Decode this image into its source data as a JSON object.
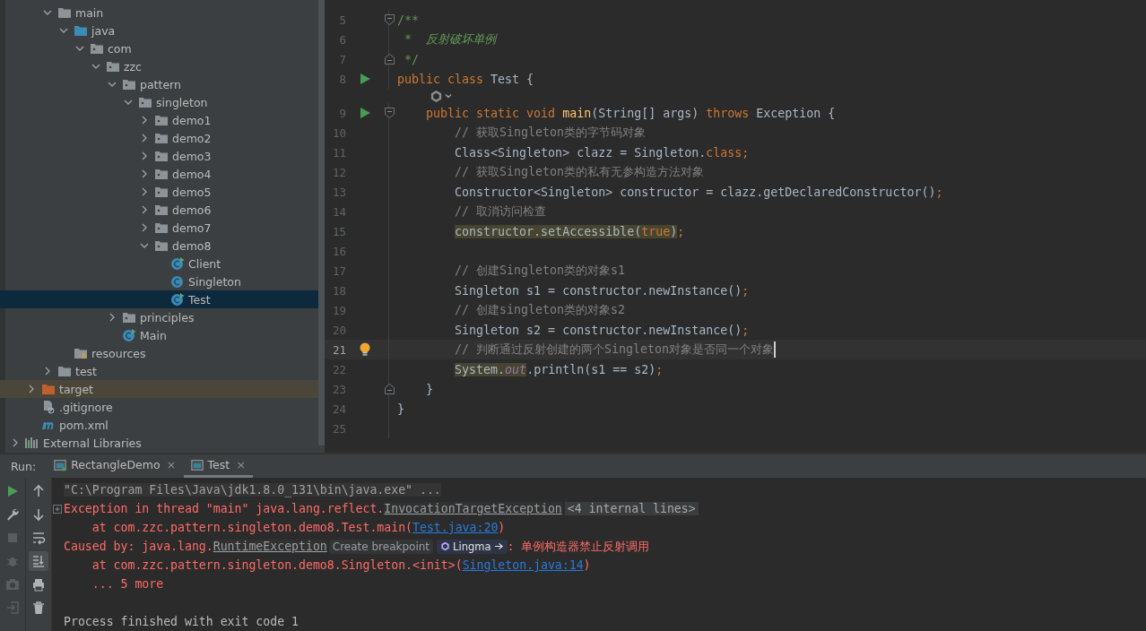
{
  "tree": [
    {
      "children": [
        {
          "children": [
            {
              "label": "main",
              "kind": "folder",
              "expanded": true,
              "selected": false,
              "children": [
                {
                  "label": "java",
                  "kind": "source",
                  "expanded": true,
                  "selected": false,
                  "children": [
                    {
                      "label": "com",
                      "kind": "package",
                      "expanded": true,
                      "selected": false,
                      "children": [
                        {
                          "label": "zzc",
                          "kind": "package",
                          "expanded": true,
                          "selected": false,
                          "children": [
                            {
                              "label": "pattern",
                              "kind": "package",
                              "expanded": true,
                              "selected": false,
                              "children": [
                                {
                                  "label": "singleton",
                                  "kind": "package",
                                  "expanded": true,
                                  "selected": false,
                                  "children": [
                                    {
                                      "label": "demo1",
                                      "kind": "package",
                                      "expanded": false,
                                      "selected": false
                                    },
                                    {
                                      "label": "demo2",
                                      "kind": "package",
                                      "expanded": false,
                                      "selected": false
                                    },
                                    {
                                      "label": "demo3",
                                      "kind": "package",
                                      "expanded": false,
                                      "selected": false
                                    },
                                    {
                                      "label": "demo4",
                                      "kind": "package",
                                      "expanded": false,
                                      "selected": false
                                    },
                                    {
                                      "label": "demo5",
                                      "kind": "package",
                                      "expanded": false,
                                      "selected": false
                                    },
                                    {
                                      "label": "demo6",
                                      "kind": "package",
                                      "expanded": false,
                                      "selected": false
                                    },
                                    {
                                      "label": "demo7",
                                      "kind": "package",
                                      "expanded": false,
                                      "selected": false
                                    },
                                    {
                                      "label": "demo8",
                                      "kind": "package",
                                      "expanded": true,
                                      "selected": false,
                                      "children": [
                                        {
                                          "label": "Client",
                                          "kind": "runnable",
                                          "selected": false
                                        },
                                        {
                                          "label": "Singleton",
                                          "kind": "class",
                                          "selected": false
                                        },
                                        {
                                          "label": "Test",
                                          "kind": "runnable",
                                          "selected": true
                                        }
                                      ]
                                    }
                                  ]
                                }
                              ]
                            },
                            {
                              "label": "principles",
                              "kind": "package",
                              "expanded": false,
                              "selected": false
                            },
                            {
                              "label": "Main",
                              "kind": "runnable",
                              "selected": false
                            }
                          ]
                        }
                      ]
                    }
                  ]
                },
                {
                  "label": "resources",
                  "kind": "resources",
                  "selected": false
                }
              ]
            },
            {
              "label": "test",
              "kind": "folder",
              "expanded": false,
              "selected": false
            }
          ]
        },
        {
          "label": "target",
          "kind": "excluded",
          "expanded": false,
          "selected": false
        },
        {
          "label": ".gitignore",
          "kind": "ignore",
          "selected": false
        },
        {
          "label": "pom.xml",
          "kind": "maven",
          "selected": false
        }
      ]
    },
    {
      "label": "External Libraries",
      "kind": "libraries",
      "expanded": false,
      "selected": false
    }
  ],
  "editor": {
    "lines": [
      {
        "kind": "code",
        "number": "5",
        "current": false,
        "gutter": [
          {
            "kind": "fold-start"
          }
        ],
        "tokens": [
          {
            "text": "/**",
            "kind": "doc"
          }
        ]
      },
      {
        "kind": "code",
        "number": "6",
        "current": false,
        "tokens": [
          {
            "text": " *  反射破坏单例",
            "kind": "doctext"
          }
        ]
      },
      {
        "kind": "code",
        "number": "7",
        "current": false,
        "gutter": [
          {
            "kind": "fold-end"
          }
        ],
        "tokens": [
          {
            "text": " */",
            "kind": "doc"
          }
        ]
      },
      {
        "kind": "code",
        "number": "8",
        "current": false,
        "gutter": [
          {
            "kind": "run"
          }
        ],
        "tokens": [
          {
            "text": "public class ",
            "kind": "keyword"
          },
          {
            "text": "Test {",
            "kind": "plain"
          }
        ]
      },
      {
        "kind": "inlay"
      },
      {
        "kind": "code",
        "number": "9",
        "current": false,
        "gutter": [
          {
            "kind": "run"
          },
          {
            "kind": "fold-start"
          }
        ],
        "tokens": [
          {
            "text": "    public static void ",
            "kind": "keyword"
          },
          {
            "text": "main",
            "kind": "method"
          },
          {
            "text": "(String[] args) ",
            "kind": "plain"
          },
          {
            "text": "throws ",
            "kind": "keyword"
          },
          {
            "text": "Exception {",
            "kind": "plain"
          }
        ]
      },
      {
        "kind": "code",
        "number": "10",
        "current": false,
        "tokens": [
          {
            "text": "        // 获取Singleton类的字节码对象",
            "kind": "comment"
          }
        ]
      },
      {
        "kind": "code",
        "number": "11",
        "current": false,
        "tokens": [
          {
            "text": "        Class<Singleton> clazz = Singleton.",
            "kind": "plain"
          },
          {
            "text": "class;",
            "kind": "keyword"
          }
        ]
      },
      {
        "kind": "code",
        "number": "12",
        "current": false,
        "tokens": [
          {
            "text": "        // 获取Singleton类的私有无参构造方法对象",
            "kind": "comment"
          }
        ]
      },
      {
        "kind": "code",
        "number": "13",
        "current": false,
        "tokens": [
          {
            "text": "        Constructor<Singleton> constructor = clazz.getDeclaredConstructor()",
            "kind": "plain"
          },
          {
            "text": ";",
            "kind": "keyword"
          }
        ]
      },
      {
        "kind": "code",
        "number": "14",
        "current": false,
        "tokens": [
          {
            "text": "        // 取消访问检查",
            "kind": "comment"
          }
        ]
      },
      {
        "kind": "code",
        "number": "15",
        "current": false,
        "tokens": [
          {
            "text": "        constructor.setAccessible(",
            "kind": "hlplain"
          },
          {
            "text": "true",
            "kind": "hlkeyword"
          },
          {
            "text": ")",
            "kind": "hlplain"
          },
          {
            "text": ";",
            "kind": "keyword"
          }
        ]
      },
      {
        "kind": "code",
        "number": "16",
        "current": false
      },
      {
        "kind": "code",
        "number": "17",
        "current": false,
        "tokens": [
          {
            "text": "        // 创建Singleton类的对象s1",
            "kind": "comment"
          }
        ]
      },
      {
        "kind": "code",
        "number": "18",
        "current": false,
        "tokens": [
          {
            "text": "        Singleton s1 = constructor.newInstance()",
            "kind": "plain"
          },
          {
            "text": ";",
            "kind": "keyword"
          }
        ]
      },
      {
        "kind": "code",
        "number": "19",
        "current": false,
        "tokens": [
          {
            "text": "        // 创建singleton类的对象s2",
            "kind": "comment"
          }
        ]
      },
      {
        "kind": "code",
        "number": "20",
        "current": false,
        "tokens": [
          {
            "text": "        Singleton s2 = constructor.newInstance()",
            "kind": "plain"
          },
          {
            "text": ";",
            "kind": "keyword"
          }
        ]
      },
      {
        "kind": "code",
        "number": "21",
        "current": true,
        "gutter": [
          {
            "kind": "bulb"
          }
        ],
        "tokens": [
          {
            "text": "        // 判断通过反射创建的两个Singleton对象是否同一个对象",
            "kind": "comment"
          }
        ]
      },
      {
        "kind": "code",
        "number": "22",
        "current": false,
        "tokens": [
          {
            "text": "        System.",
            "kind": "hlplain"
          },
          {
            "text": "out",
            "kind": "hlfield"
          },
          {
            "text": ".println(s1 == s2)",
            "kind": "plain"
          },
          {
            "text": ";",
            "kind": "keyword"
          }
        ]
      },
      {
        "kind": "code",
        "number": "23",
        "current": false,
        "gutter": [
          {
            "kind": "fold-end"
          }
        ],
        "tokens": [
          {
            "text": "    }",
            "kind": "plain"
          }
        ]
      },
      {
        "kind": "code",
        "number": "24",
        "current": false,
        "tokens": [
          {
            "text": "}",
            "kind": "plain"
          }
        ]
      },
      {
        "kind": "code",
        "number": "25",
        "current": false
      }
    ]
  },
  "run": {
    "label": "Run:",
    "tabs": [
      {
        "label": "RectangleDemo",
        "selected": false,
        "close": "×"
      },
      {
        "label": "Test",
        "selected": true,
        "close": "×"
      }
    ],
    "tools_left": [
      {
        "kind": "run",
        "disabled": false,
        "selected": false
      },
      {
        "kind": "wrench",
        "disabled": false,
        "selected": false
      },
      {
        "kind": "stop",
        "disabled": true,
        "selected": false
      },
      {
        "kind": "bug",
        "disabled": true,
        "selected": false
      },
      {
        "kind": "camera",
        "disabled": true,
        "selected": false
      },
      {
        "kind": "exit",
        "disabled": true,
        "selected": false
      }
    ],
    "tools_right": [
      {
        "kind": "up",
        "disabled": false,
        "selected": false
      },
      {
        "kind": "down",
        "disabled": false,
        "selected": false
      },
      {
        "kind": "wrap",
        "disabled": false,
        "selected": false
      },
      {
        "kind": "scroll-end",
        "disabled": false,
        "selected": true
      },
      {
        "kind": "print",
        "disabled": false,
        "selected": false
      },
      {
        "kind": "trash",
        "disabled": false,
        "selected": false
      }
    ],
    "console": [
      {
        "folded": false,
        "tokens": [
          {
            "text": "\"C:\\Program Files\\Java\\jdk1.8.0_131\\bin\\java.exe\" ...",
            "kind": "command"
          }
        ]
      },
      {
        "folded": true,
        "tokens": [
          {
            "text": "Exception in thread \"main\" java.lang.reflect.",
            "kind": "error"
          },
          {
            "text": "InvocationTargetException",
            "kind": "errorlink"
          },
          {
            "text": "<4 internal lines>",
            "kind": "chip"
          }
        ]
      },
      {
        "folded": false,
        "tokens": [
          {
            "text": "    at com.zzc.pattern.singleton.demo8.Test.main(",
            "kind": "error"
          },
          {
            "text": "Test.java:20",
            "kind": "link"
          },
          {
            "text": ")",
            "kind": "error"
          }
        ]
      },
      {
        "folded": false,
        "tokens": [
          {
            "text": "Caused by: java.lang.",
            "kind": "error"
          },
          {
            "text": "RuntimeException",
            "kind": "errorlink"
          },
          {
            "text": "Create breakpoint",
            "kind": "button"
          },
          {
            "text": "Lingma",
            "kind": "assistant"
          },
          {
            "text": ": 单例构造器禁止反射调用",
            "kind": "error"
          }
        ]
      },
      {
        "folded": false,
        "tokens": [
          {
            "text": "    at com.zzc.pattern.singleton.demo8.Singleton.<init>(",
            "kind": "error"
          },
          {
            "text": "Singleton.java:14",
            "kind": "link"
          },
          {
            "text": ")",
            "kind": "error"
          }
        ]
      },
      {
        "folded": false,
        "tokens": [
          {
            "text": "    ... 5 more",
            "kind": "error"
          }
        ]
      },
      {
        "folded": false
      },
      {
        "folded": false,
        "tokens": [
          {
            "text": "Process finished with exit code 1",
            "kind": "plain"
          }
        ]
      }
    ]
  }
}
